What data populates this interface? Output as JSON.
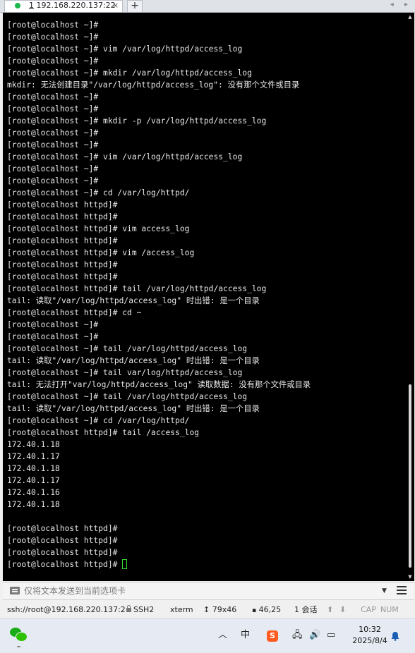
{
  "tab": {
    "number": "1",
    "title": "192.168.220.137:22",
    "close": "×",
    "add": "+",
    "nav_arrows": "◂ ▸"
  },
  "terminal": {
    "lines": [
      "[root@localhost ~]#",
      "[root@localhost ~]#",
      "[root@localhost ~]# vim /var/log/httpd/access_log",
      "[root@localhost ~]#",
      "[root@localhost ~]# mkdir /var/log/httpd/access_log",
      "mkdir: 无法创建目录\"/var/log/httpd/access_log\": 没有那个文件或目录",
      "[root@localhost ~]#",
      "[root@localhost ~]#",
      "[root@localhost ~]# mkdir -p /var/log/httpd/access_log",
      "[root@localhost ~]#",
      "[root@localhost ~]#",
      "[root@localhost ~]# vim /var/log/httpd/access_log",
      "[root@localhost ~]#",
      "[root@localhost ~]#",
      "[root@localhost ~]# cd /var/log/httpd/",
      "[root@localhost httpd]#",
      "[root@localhost httpd]#",
      "[root@localhost httpd]# vim access_log",
      "[root@localhost httpd]#",
      "[root@localhost httpd]# vim /access_log",
      "[root@localhost httpd]#",
      "[root@localhost httpd]#",
      "[root@localhost httpd]# tail /var/log/httpd/access_log",
      "tail: 读取\"/var/log/httpd/access_log\" 时出错: 是一个目录",
      "[root@localhost httpd]# cd ~",
      "[root@localhost ~]#",
      "[root@localhost ~]#",
      "[root@localhost ~]# tail /var/log/httpd/access_log",
      "tail: 读取\"/var/log/httpd/access_log\" 时出错: 是一个目录",
      "[root@localhost ~]# tail var/log/httpd/access_log",
      "tail: 无法打开\"var/log/httpd/access_log\" 读取数据: 没有那个文件或目录",
      "[root@localhost ~]# tail /var/log/httpd/access_log",
      "tail: 读取\"/var/log/httpd/access_log\" 时出错: 是一个目录",
      "[root@localhost ~]# cd /var/log/httpd/",
      "[root@localhost httpd]# tail /access_log",
      "172.40.1.18",
      "172.40.1.17",
      "172.40.1.18",
      "172.40.1.17",
      "172.40.1.16",
      "172.40.1.18",
      "",
      "[root@localhost httpd]#",
      "[root@localhost httpd]#",
      "[root@localhost httpd]#"
    ],
    "prompt": "[root@localhost httpd]# ",
    "cursor_color": "#33e033",
    "background": "#000000",
    "foreground": "#e8e8e8"
  },
  "compose": {
    "placeholder": "仅将文本发送到当前选项卡",
    "dropdown": "▼"
  },
  "statusbar": {
    "connection": "ssh://root@192.168.220.137:2",
    "protocol": "SSH2",
    "term": "xterm",
    "size_icon": "↕",
    "size": "79x46",
    "pos_icon": "▪",
    "position": "46,25",
    "sessions": "1 会话",
    "up_arrow": "⬆",
    "down_arrow": "⬇",
    "cap": "CAP",
    "num": "NUM"
  },
  "taskbar": {
    "chevron": "︿",
    "ime": "中",
    "sogou": "S",
    "network": "🖧",
    "volume": "🔊",
    "battery": "▭",
    "time": "10:32",
    "date": "2025/8/4",
    "icons": [
      "wechat-icon",
      "chevron-up-icon",
      "ime-icon",
      "sogou-icon",
      "network-icon",
      "volume-icon",
      "battery-icon",
      "notification-bell-icon"
    ]
  }
}
